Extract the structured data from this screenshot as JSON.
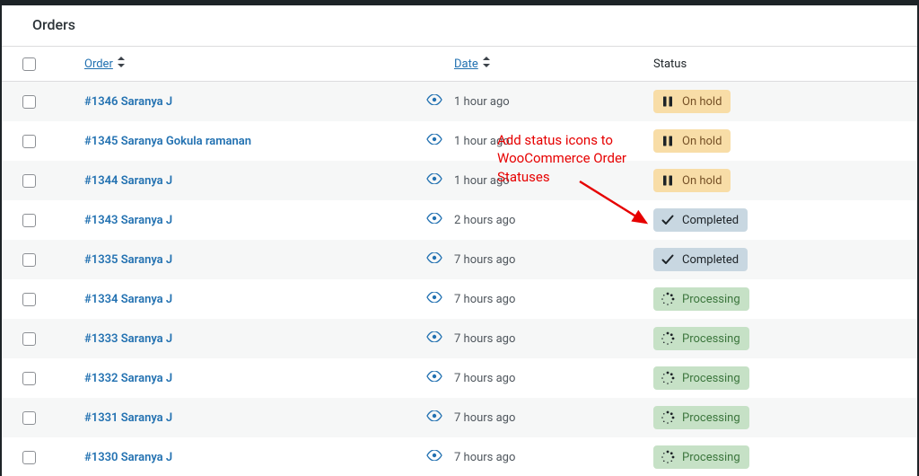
{
  "page_title": "Orders",
  "columns": {
    "order": "Order",
    "date": "Date",
    "status": "Status"
  },
  "statuses": {
    "on-hold": {
      "label": "On hold",
      "class": "status-onhold",
      "icon": "pause-icon"
    },
    "completed": {
      "label": "Completed",
      "class": "status-completed",
      "icon": "check-icon"
    },
    "processing": {
      "label": "Processing",
      "class": "status-processing",
      "icon": "spinner-icon"
    }
  },
  "orders": [
    {
      "id": "#1346",
      "customer": "Saranya J",
      "date": "1 hour ago",
      "status": "on-hold"
    },
    {
      "id": "#1345",
      "customer": "Saranya Gokula ramanan",
      "date": "1 hour ago",
      "status": "on-hold"
    },
    {
      "id": "#1344",
      "customer": "Saranya J",
      "date": "1 hour ago",
      "status": "on-hold"
    },
    {
      "id": "#1343",
      "customer": "Saranya J",
      "date": "2 hours ago",
      "status": "completed"
    },
    {
      "id": "#1335",
      "customer": "Saranya J",
      "date": "7 hours ago",
      "status": "completed"
    },
    {
      "id": "#1334",
      "customer": "Saranya J",
      "date": "7 hours ago",
      "status": "processing"
    },
    {
      "id": "#1333",
      "customer": "Saranya J",
      "date": "7 hours ago",
      "status": "processing"
    },
    {
      "id": "#1332",
      "customer": "Saranya J",
      "date": "7 hours ago",
      "status": "processing"
    },
    {
      "id": "#1331",
      "customer": "Saranya J",
      "date": "7 hours ago",
      "status": "processing"
    },
    {
      "id": "#1330",
      "customer": "Saranya J",
      "date": "7 hours ago",
      "status": "processing"
    }
  ],
  "annotation": {
    "text": "Add status icons to WooCommerce Order Statuses"
  }
}
